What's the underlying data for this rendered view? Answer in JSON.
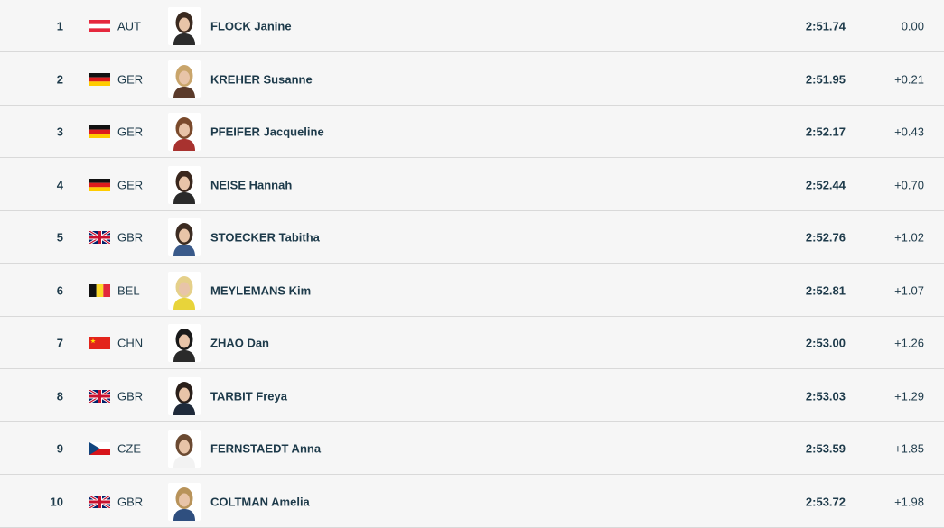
{
  "results": [
    {
      "rank": "1",
      "noc": "AUT",
      "flag_icon": "austria-flag-icon",
      "name": "FLOCK Janine",
      "time": "2:51.74",
      "diff": "0.00",
      "hair": "#3b2a20",
      "shirt": "#2b2b2b"
    },
    {
      "rank": "2",
      "noc": "GER",
      "flag_icon": "germany-flag-icon",
      "name": "KREHER Susanne",
      "time": "2:51.95",
      "diff": "+0.21",
      "hair": "#c9a56b",
      "shirt": "#5a3a2a"
    },
    {
      "rank": "3",
      "noc": "GER",
      "flag_icon": "germany-flag-icon",
      "name": "PFEIFER Jacqueline",
      "time": "2:52.17",
      "diff": "+0.43",
      "hair": "#7a4a2c",
      "shirt": "#a8322f"
    },
    {
      "rank": "4",
      "noc": "GER",
      "flag_icon": "germany-flag-icon",
      "name": "NEISE Hannah",
      "time": "2:52.44",
      "diff": "+0.70",
      "hair": "#3a271d",
      "shirt": "#2a2a2a"
    },
    {
      "rank": "5",
      "noc": "GBR",
      "flag_icon": "uk-flag-icon",
      "name": "STOECKER Tabitha",
      "time": "2:52.76",
      "diff": "+1.02",
      "hair": "#3c2c22",
      "shirt": "#3a5a8a"
    },
    {
      "rank": "6",
      "noc": "BEL",
      "flag_icon": "belgium-flag-icon",
      "name": "MEYLEMANS Kim",
      "time": "2:52.81",
      "diff": "+1.07",
      "hair": "#e5d08a",
      "shirt": "#e8d43a"
    },
    {
      "rank": "7",
      "noc": "CHN",
      "flag_icon": "china-flag-icon",
      "name": "ZHAO Dan",
      "time": "2:53.00",
      "diff": "+1.26",
      "hair": "#1a1a1a",
      "shirt": "#2a2a2a"
    },
    {
      "rank": "8",
      "noc": "GBR",
      "flag_icon": "uk-flag-icon",
      "name": "TARBIT Freya",
      "time": "2:53.03",
      "diff": "+1.29",
      "hair": "#2a1f1a",
      "shirt": "#1f2a3a"
    },
    {
      "rank": "9",
      "noc": "CZE",
      "flag_icon": "czech-flag-icon",
      "name": "FERNSTAEDT Anna",
      "time": "2:53.59",
      "diff": "+1.85",
      "hair": "#6b4a32",
      "shirt": "#f2f2f2"
    },
    {
      "rank": "10",
      "noc": "GBR",
      "flag_icon": "uk-flag-icon",
      "name": "COLTMAN Amelia",
      "time": "2:53.72",
      "diff": "+1.98",
      "hair": "#b8935a",
      "shirt": "#2f4f7f"
    }
  ]
}
